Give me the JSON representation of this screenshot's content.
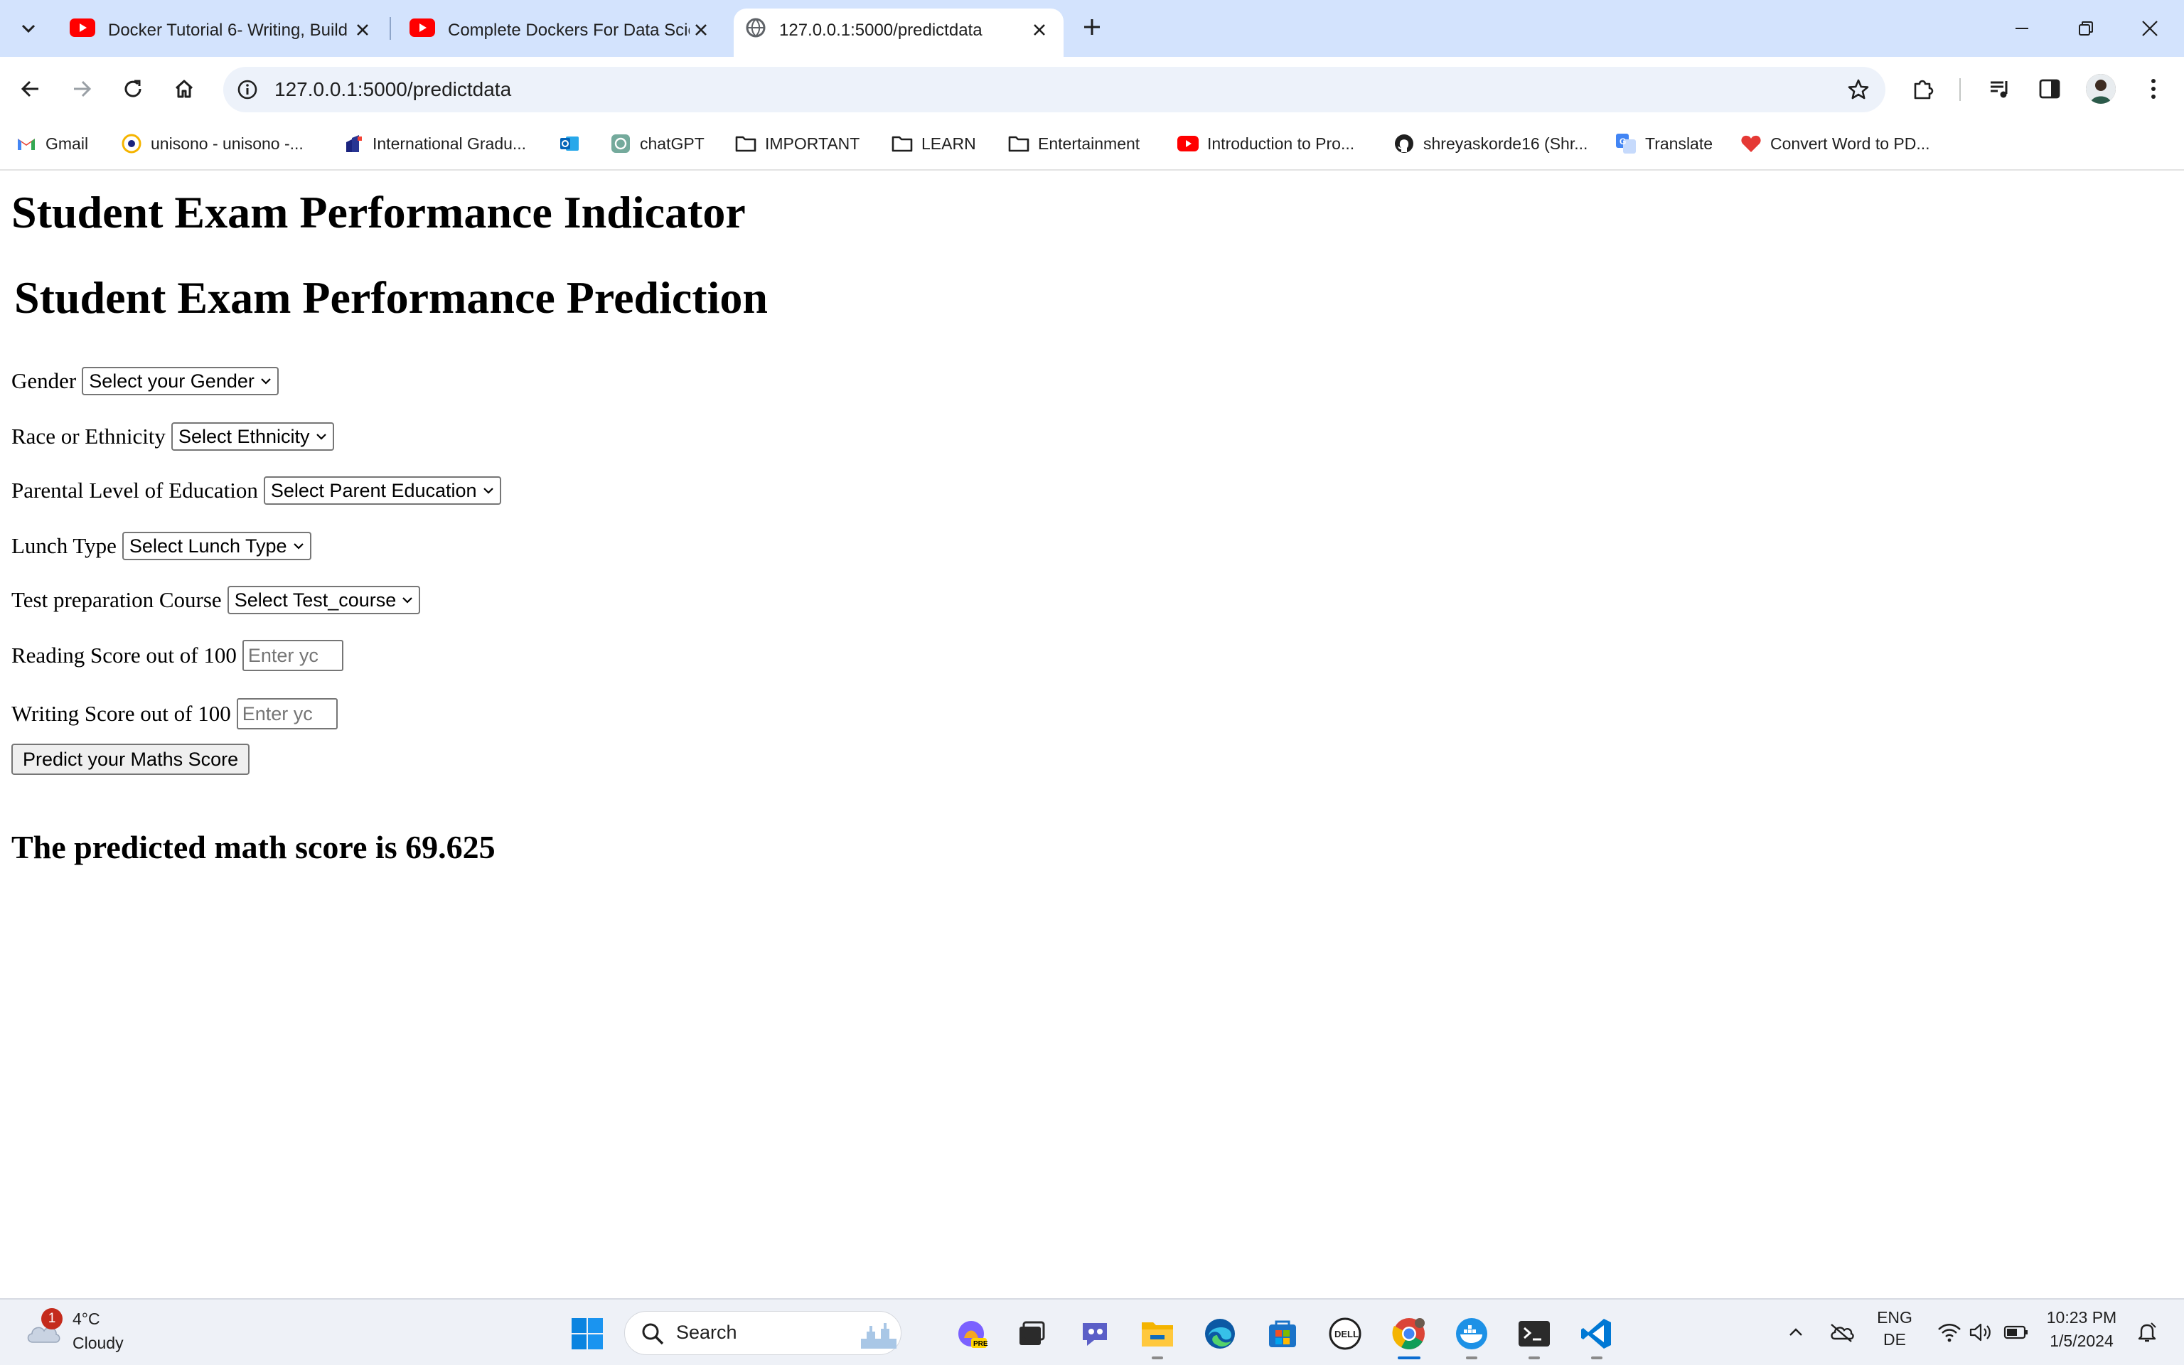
{
  "browser": {
    "tabs": [
      {
        "title": "Docker Tutorial 6- Writing, Build",
        "favicon": "youtube-icon",
        "active": false
      },
      {
        "title": "Complete Dockers For Data Scie",
        "favicon": "youtube-icon",
        "active": false
      },
      {
        "title": "127.0.0.1:5000/predictdata",
        "favicon": "globe-icon",
        "active": true
      }
    ],
    "url": "127.0.0.1:5000/predictdata",
    "bookmarks": [
      {
        "label": "Gmail",
        "icon": "gmail-icon"
      },
      {
        "label": "unisono - unisono -...",
        "icon": "unisono-icon"
      },
      {
        "label": "International Gradu...",
        "icon": "university-icon"
      },
      {
        "label": "",
        "icon": "outlook-icon"
      },
      {
        "label": "chatGPT",
        "icon": "chatgpt-icon"
      },
      {
        "label": "IMPORTANT",
        "icon": "folder-icon"
      },
      {
        "label": "LEARN",
        "icon": "folder-icon"
      },
      {
        "label": "Entertainment",
        "icon": "folder-icon"
      },
      {
        "label": "Introduction to Pro...",
        "icon": "youtube-icon"
      },
      {
        "label": "shreyaskorde16 (Shr...",
        "icon": "github-icon"
      },
      {
        "label": "Translate",
        "icon": "translate-icon"
      },
      {
        "label": "Convert Word to PD...",
        "icon": "heart-icon"
      }
    ]
  },
  "page": {
    "heading": "Student Exam Performance Indicator",
    "subheading": "Student Exam Performance Prediction",
    "fields": [
      {
        "label": "Gender",
        "type": "select",
        "value": "Select your Gender"
      },
      {
        "label": "Race or Ethnicity",
        "type": "select",
        "value": "Select Ethnicity"
      },
      {
        "label": "Parental Level of Education",
        "type": "select",
        "value": "Select Parent Education"
      },
      {
        "label": "Lunch Type",
        "type": "select",
        "value": "Select Lunch Type"
      },
      {
        "label": "Test preparation Course",
        "type": "select",
        "value": "Select Test_course"
      },
      {
        "label": "Reading Score out of 100",
        "type": "text",
        "placeholder": "Enter yc"
      },
      {
        "label": "Writing Score out of 100",
        "type": "text",
        "placeholder": "Enter yc"
      }
    ],
    "submit_label": "Predict your Maths Score",
    "result": "The predicted math score is 69.625"
  },
  "taskbar": {
    "weather": {
      "badge": "1",
      "temp": "4°C",
      "condition": "Cloudy"
    },
    "search_label": "Search",
    "language": [
      "ENG",
      "DE"
    ],
    "time": "10:23 PM",
    "date": "1/5/2024"
  },
  "colors": {
    "tabstrip": "#d3e3fd",
    "omnibox": "#edf2fa",
    "taskbar": "#eef1f7",
    "youtube_red": "#ff0000"
  }
}
